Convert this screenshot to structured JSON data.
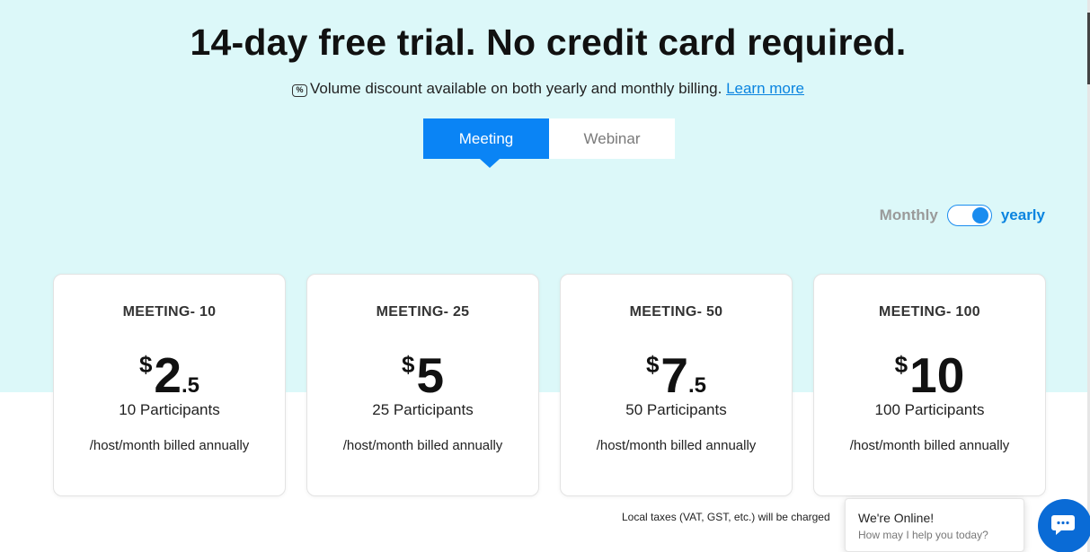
{
  "headline": "14-day free trial. No credit card required.",
  "discount": {
    "icon": "percent-tag-icon",
    "text": "Volume discount available on both yearly and monthly billing.",
    "link": "Learn more"
  },
  "tabs": [
    {
      "label": "Meeting",
      "active": true
    },
    {
      "label": "Webinar",
      "active": false
    }
  ],
  "billing": {
    "monthly": "Monthly",
    "yearly": "yearly",
    "selected": "yearly"
  },
  "plans": [
    {
      "title": "MEETING- 10",
      "currency": "$",
      "price_int": "2",
      "price_dec": ".5",
      "participants": "10 Participants",
      "billed": "/host/month billed annually"
    },
    {
      "title": "MEETING- 25",
      "currency": "$",
      "price_int": "5",
      "price_dec": "",
      "participants": "25 Participants",
      "billed": "/host/month billed annually"
    },
    {
      "title": "MEETING- 50",
      "currency": "$",
      "price_int": "7",
      "price_dec": ".5",
      "participants": "50 Participants",
      "billed": "/host/month billed annually"
    },
    {
      "title": "MEETING- 100",
      "currency": "$",
      "price_int": "10",
      "price_dec": "",
      "participants": "100 Participants",
      "billed": "/host/month billed annually"
    }
  ],
  "tax_note": "Local taxes (VAT, GST, etc.) will be charged",
  "chat": {
    "title": "We're Online!",
    "subtitle": "How may I help you today?",
    "icon": "chat-bubble-icon"
  },
  "colors": {
    "accent": "#0a84f5",
    "hero_bg": "#dcf8f9"
  }
}
